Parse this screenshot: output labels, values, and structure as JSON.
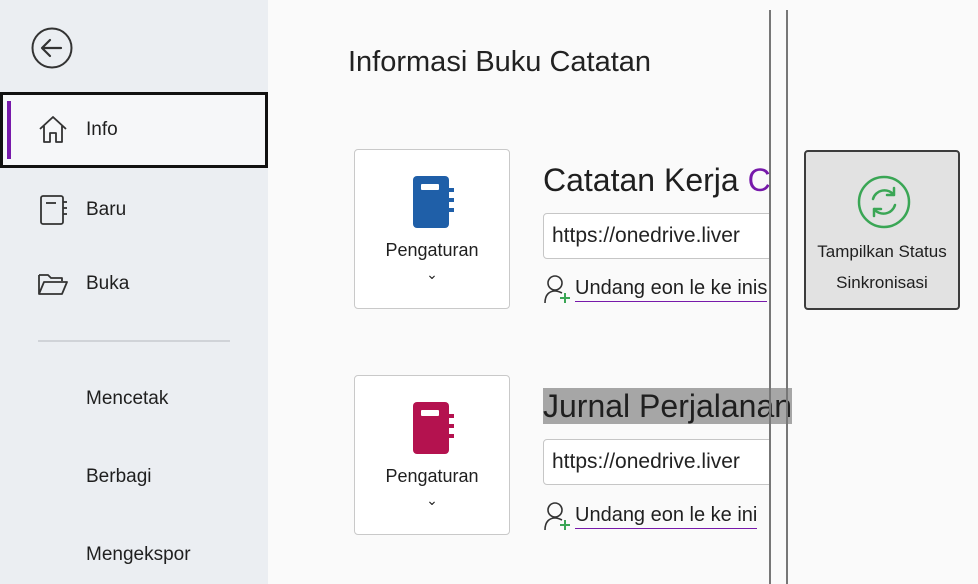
{
  "nav": {
    "items": [
      {
        "label": "Info",
        "icon": "home-icon"
      },
      {
        "label": "Baru",
        "icon": "notebook-new-icon"
      },
      {
        "label": "Buka",
        "icon": "folder-open-icon"
      }
    ],
    "text_items": [
      "Mencetak",
      "Berbagi",
      "Mengekspor"
    ]
  },
  "main": {
    "title": "Informasi Buku Catatan",
    "notebooks": [
      {
        "name": "Catatan Kerja",
        "name_suffix": "C",
        "color": "#1f5fa8",
        "settings_label": "Pengaturan",
        "url": "https://onedrive.liver",
        "invite": "Undang eon le ke inis"
      },
      {
        "name": "Jurnal Perjalanan",
        "color": "#b4124f",
        "settings_label": "Pengaturan",
        "url": "https://onedrive.liver",
        "invite": "Undang eon le ke ini"
      }
    ],
    "sync": {
      "line1": "Tampilkan Status",
      "line2": "Sinkronisasi",
      "color": "#3aa655"
    }
  }
}
